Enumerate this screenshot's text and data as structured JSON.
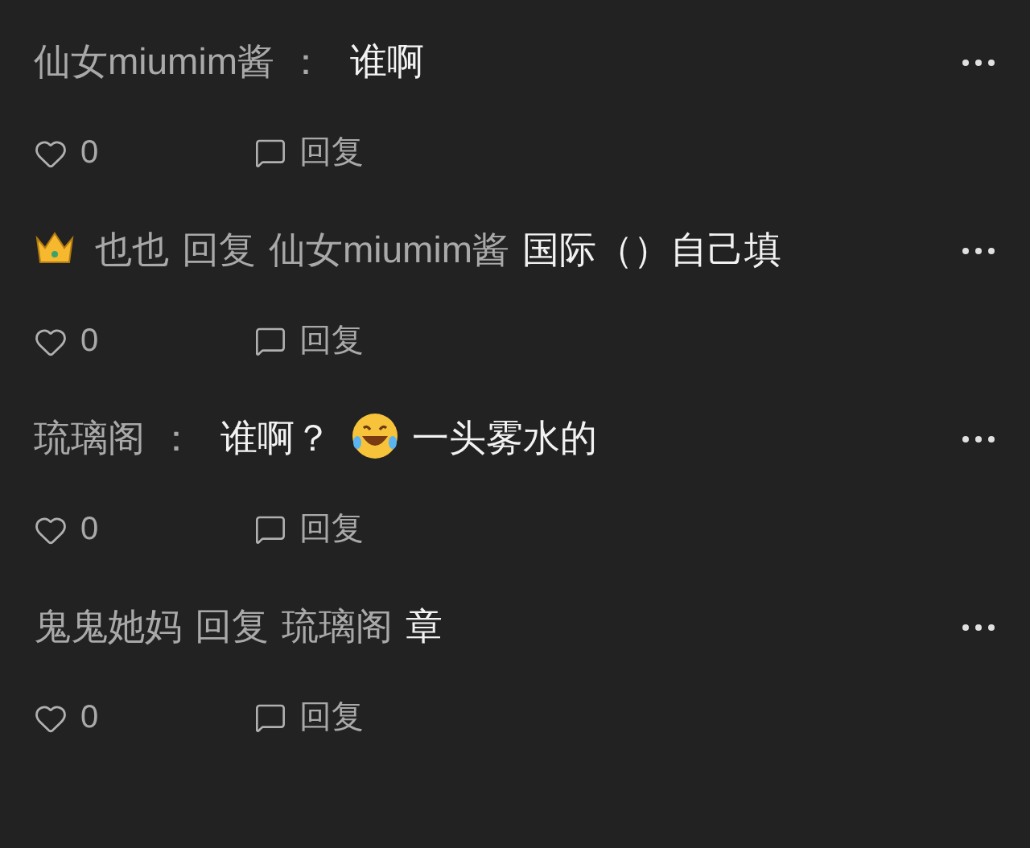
{
  "comments": [
    {
      "segments": [
        {
          "kind": "author",
          "text": "仙女miumim酱"
        },
        {
          "kind": "separator",
          "text": "："
        },
        {
          "kind": "text",
          "text": "谁啊"
        }
      ],
      "likes": "0",
      "reply_label": "回复"
    },
    {
      "segments": [
        {
          "kind": "badge"
        },
        {
          "kind": "author",
          "text": "也也"
        },
        {
          "kind": "reply",
          "text": "回复"
        },
        {
          "kind": "author",
          "text": "仙女miumim酱"
        },
        {
          "kind": "text",
          "text": "国际（）自己填"
        }
      ],
      "likes": "0",
      "reply_label": "回复"
    },
    {
      "segments": [
        {
          "kind": "author",
          "text": "琉璃阁"
        },
        {
          "kind": "separator",
          "text": "："
        },
        {
          "kind": "text",
          "text": "谁啊？"
        },
        {
          "kind": "emoji"
        },
        {
          "kind": "text",
          "text": "一头雾水的"
        }
      ],
      "likes": "0",
      "reply_label": "回复"
    },
    {
      "segments": [
        {
          "kind": "author",
          "text": "鬼鬼她妈"
        },
        {
          "kind": "reply",
          "text": "回复"
        },
        {
          "kind": "author",
          "text": "琉璃阁"
        },
        {
          "kind": "text",
          "text": "章"
        }
      ],
      "likes": "0",
      "reply_label": "回复"
    }
  ]
}
